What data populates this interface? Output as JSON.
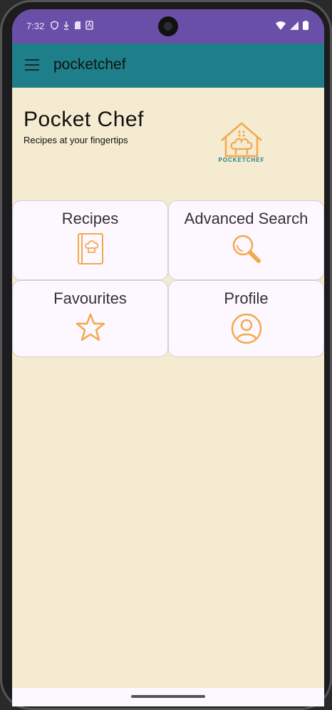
{
  "status_bar": {
    "time": "7:32"
  },
  "app_bar": {
    "title": "pocketchef"
  },
  "hero": {
    "title": "Pocket Chef",
    "subtitle": "Recipes at your fingertips",
    "logo_text": "POCKETCHEF"
  },
  "cards": [
    {
      "label": "Recipes",
      "icon": "cookbook-icon"
    },
    {
      "label": "Advanced Search",
      "icon": "search-icon"
    },
    {
      "label": "Favourites",
      "icon": "star-icon"
    },
    {
      "label": "Profile",
      "icon": "profile-icon"
    }
  ],
  "colors": {
    "status": "#6a4fa8",
    "appbar": "#1e7f8a",
    "background": "#f5ebd0",
    "accent": "#f2a94e"
  }
}
